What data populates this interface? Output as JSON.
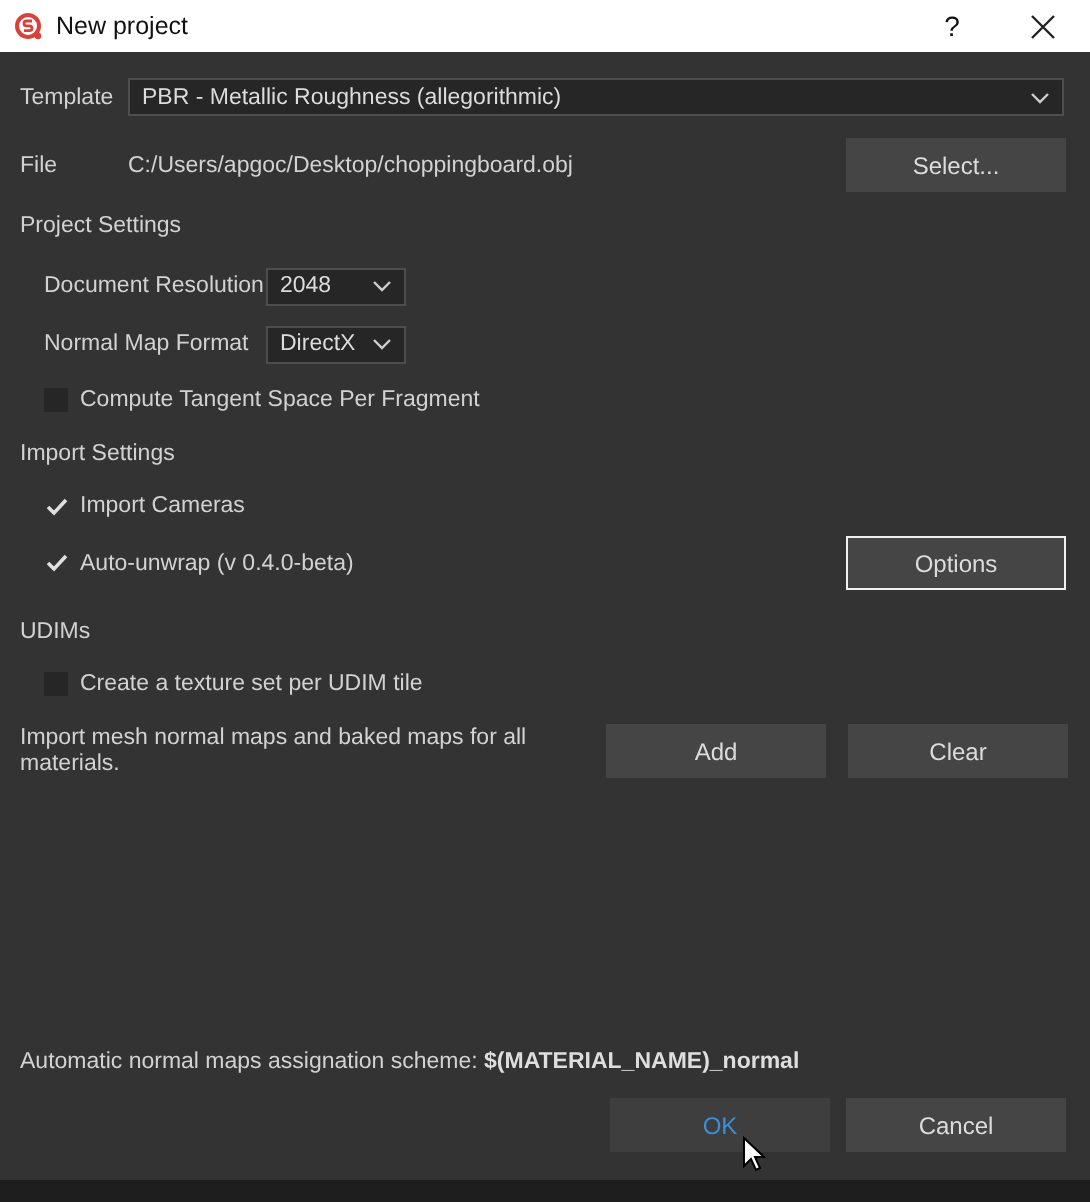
{
  "window": {
    "title": "New project",
    "help": "?"
  },
  "template": {
    "label": "Template",
    "value": "PBR - Metallic Roughness (allegorithmic)"
  },
  "file": {
    "label": "File",
    "path": "C:/Users/apgoc/Desktop/choppingboard.obj",
    "button": {
      "label": "Select...",
      "focused": false
    }
  },
  "sections": [
    {
      "heading": "Project Settings",
      "items": [
        {
          "kind": "dropdown",
          "label": "Document Resolution",
          "value": "2048"
        },
        {
          "kind": "dropdown",
          "label": "Normal Map Format",
          "value": "DirectX"
        },
        {
          "kind": "checkbox",
          "label": "Compute Tangent Space Per Fragment",
          "checked": false
        }
      ]
    },
    {
      "heading": "Import Settings",
      "items": [
        {
          "kind": "checkbox",
          "label": "Import Cameras",
          "checked": true
        },
        {
          "kind": "checkbox",
          "label": "Auto-unwrap (v 0.4.0-beta)",
          "checked": true,
          "button": {
            "label": "Options",
            "focused": true
          }
        }
      ]
    },
    {
      "heading": "UDIMs",
      "items": [
        {
          "kind": "checkbox",
          "label": "Create a texture set per UDIM tile",
          "checked": false
        }
      ]
    }
  ],
  "maps": {
    "text": "Import mesh normal maps and baked maps for all materials.",
    "buttons": [
      {
        "label": "Add",
        "focused": false
      },
      {
        "label": "Clear",
        "focused": false
      }
    ]
  },
  "scheme": "Automatic normal maps assignation scheme: **$(MATERIAL_NAME)_normal**",
  "buttons": [
    {
      "label": "OK",
      "hovered": true
    },
    {
      "label": "Cancel",
      "hovered": false
    }
  ]
}
